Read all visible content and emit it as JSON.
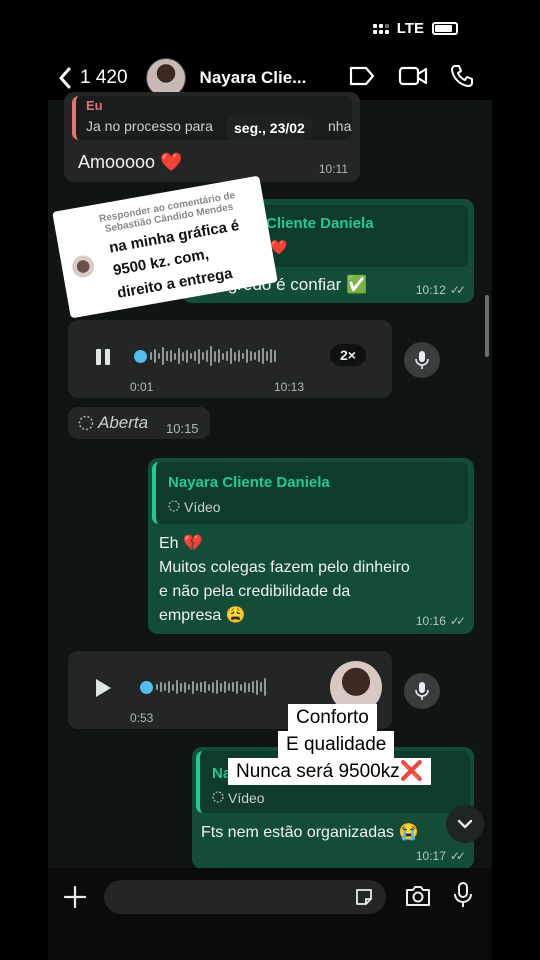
{
  "status_bar": {
    "network": "LTE"
  },
  "header": {
    "back_count": "1 420",
    "contact_name": "Nayara Clie..."
  },
  "date_pill": "seg., 23/02",
  "messages": {
    "m1": {
      "quote_name": "Eu",
      "quote_text": "Ja no processo para",
      "quote_text_tail": "nha",
      "text": "Amooooo ❤️",
      "time": "10:11"
    },
    "m2": {
      "quote_name": "Cliente Daniela",
      "quote_text": "❤️",
      "text": "O segredo é confiar ✅",
      "time": "10:12"
    },
    "m3": {
      "elapsed": "0:01",
      "time": "10:13",
      "speed": "2×"
    },
    "m4": {
      "text": "Aberta",
      "time": "10:15"
    },
    "m5": {
      "quote_name": "Nayara Cliente Daniela",
      "quote_label": "Vídeo",
      "line1": "Eh 💔",
      "line2": "Muitos colegas fazem pelo dinheiro",
      "line3": "e não pela credibilidade da",
      "line4": "empresa 😩",
      "time": "10:16"
    },
    "m6": {
      "duration": "0:53",
      "time": "10"
    },
    "m7": {
      "quote_name": "Na",
      "quote_label": "Vídeo",
      "text": "Fts nem estão organizadas 😭",
      "time": "10:17"
    }
  },
  "overlay": {
    "reply_label_1": "Responder ao comentário de",
    "reply_label_2": "Sebastião Cândido Mendes",
    "line1": "na minha gráfica é",
    "line2": "9500 kz. com,",
    "line3": "direito a entrega"
  },
  "captions": {
    "c1": "Conforto",
    "c2": "E qualidade",
    "c3": "Nunca será 9500kz❌"
  },
  "colors": {
    "outgoing": "#144d37",
    "incoming": "#242626",
    "accent": "#20c997"
  }
}
